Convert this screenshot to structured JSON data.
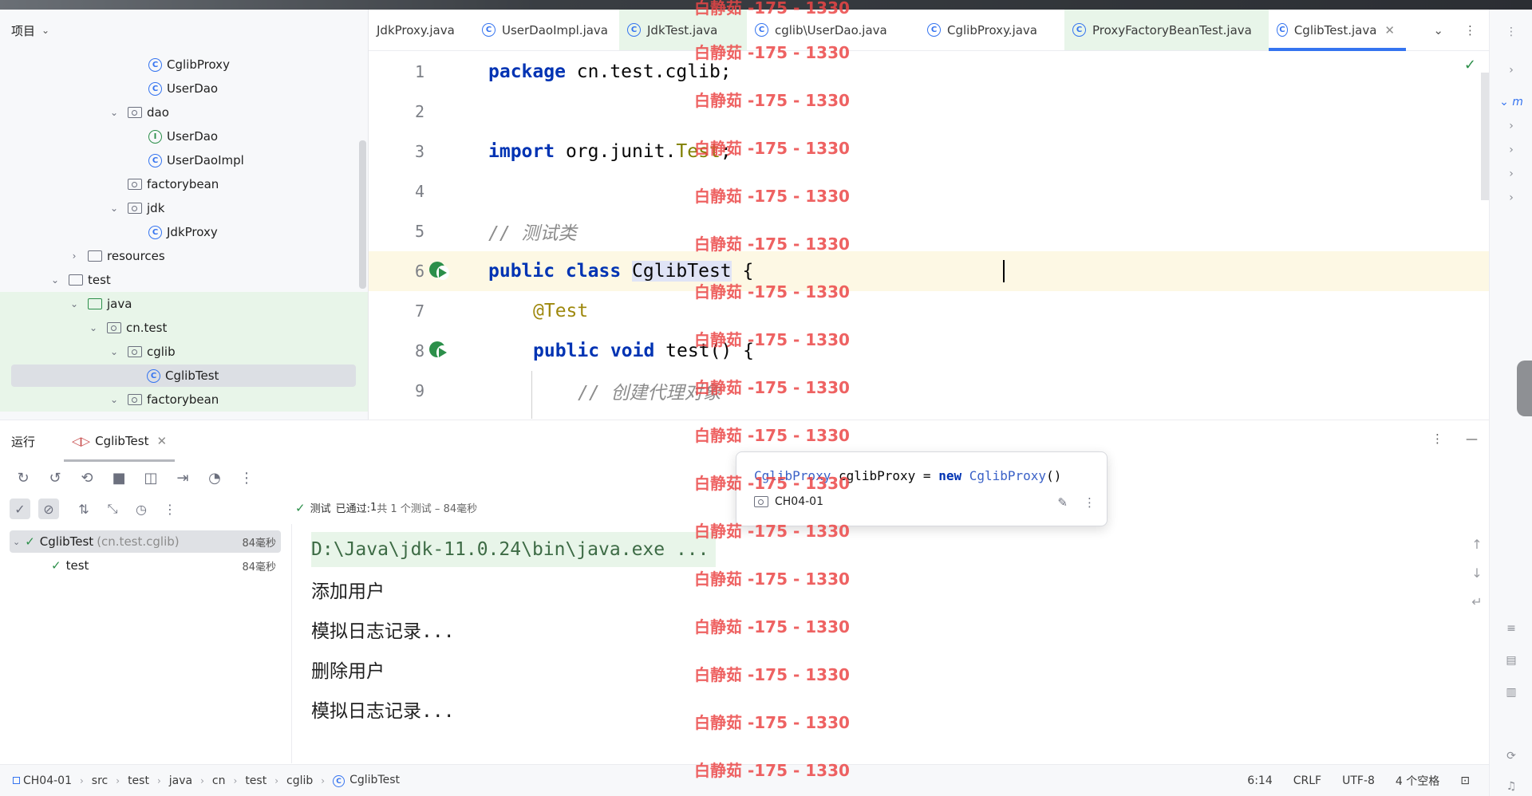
{
  "project_panel": {
    "title": "项目",
    "tree": [
      {
        "label": "CglibProxy",
        "icon": "class-icon",
        "depth": 4
      },
      {
        "label": "UserDao",
        "icon": "class-icon",
        "depth": 4
      },
      {
        "label": "dao",
        "icon": "package-icon",
        "depth": 3,
        "expanded": true
      },
      {
        "label": "UserDao",
        "icon": "interface-icon",
        "depth": 4
      },
      {
        "label": "UserDaoImpl",
        "icon": "class-icon",
        "depth": 4
      },
      {
        "label": "factorybean",
        "icon": "package-icon",
        "depth": 3
      },
      {
        "label": "jdk",
        "icon": "package-icon",
        "depth": 3,
        "expanded": true
      },
      {
        "label": "JdkProxy",
        "icon": "class-icon",
        "depth": 4
      },
      {
        "label": "resources",
        "icon": "folder-icon",
        "depth": 2,
        "collapsed": true
      },
      {
        "label": "test",
        "icon": "folder-icon",
        "depth": 1,
        "expanded": true
      },
      {
        "label": "java",
        "icon": "folder-icon",
        "depth": 2,
        "expanded": true
      },
      {
        "label": "cn.test",
        "icon": "package-icon",
        "depth": 3,
        "expanded": true
      },
      {
        "label": "cglib",
        "icon": "package-icon",
        "depth": 4,
        "expanded": true
      },
      {
        "label": "CglibTest",
        "icon": "test-class-icon",
        "depth": 5
      },
      {
        "label": "factorybean",
        "icon": "package-icon",
        "depth": 4,
        "expanded": true
      }
    ]
  },
  "editor_tabs": [
    {
      "label": "JdkProxy.java"
    },
    {
      "label": "UserDaoImpl.java"
    },
    {
      "label": "JdkTest.java"
    },
    {
      "label": "cglib\\UserDao.java"
    },
    {
      "label": "CglibProxy.java"
    },
    {
      "label": "ProxyFactoryBeanTest.java"
    },
    {
      "label": "CglibTest.java",
      "active": true
    }
  ],
  "editor": {
    "line_numbers": [
      "1",
      "2",
      "3",
      "4",
      "5",
      "6",
      "7",
      "8",
      "9"
    ],
    "lines": {
      "l1_kw": "package",
      "l1_rest": " cn.test.cglib;",
      "l3_kw": "import",
      "l3_pre": " org.junit.",
      "l3_cls": "Test",
      "l3_end": ";",
      "l5": "// 测试类",
      "l6_kw": "public class",
      "l6_sp": " ",
      "l6_name": "CglibTest",
      "l6_end": " {",
      "l7": "@Test",
      "l8_kw": "public void",
      "l8_rest": " test() {",
      "l9": "// 创建代理对象"
    }
  },
  "run_panel": {
    "title": "运行",
    "tab_label": "CglibTest",
    "status_prefix": "测试",
    "status_passed": "已通过:",
    "status_count": "1",
    "status_detail": "共 1 个测试 – 84毫秒",
    "tests": [
      {
        "name": "CglibTest",
        "package": "(cn.test.cglib)",
        "time": "84毫秒"
      },
      {
        "name": "test",
        "time": "84毫秒"
      }
    ],
    "console": [
      "D:\\Java\\jdk-11.0.24\\bin\\java.exe ...",
      "添加用户",
      "模拟日志记录...",
      "删除用户",
      "模拟日志记录..."
    ]
  },
  "popup": {
    "code_type": "CglibProxy",
    "code_var": " cglibProxy = ",
    "code_new": "new",
    "code_ctor": " CglibProxy",
    "code_end": "()",
    "module": "CH04-01"
  },
  "statusbar": {
    "breadcrumb": [
      "CH04-01",
      "src",
      "test",
      "java",
      "cn",
      "test",
      "cglib",
      "CglibTest"
    ],
    "position": "6:14",
    "line_sep": "CRLF",
    "encoding": "UTF-8",
    "indent": "4 个空格"
  },
  "watermark": {
    "text": "白静茹 -175 - 1330",
    "color": "#eb4646"
  },
  "colors": {
    "accent": "#3574f0",
    "success": "#2c8f4a",
    "current_line": "#fdf8e4",
    "green_row": "#e8f5e9"
  }
}
